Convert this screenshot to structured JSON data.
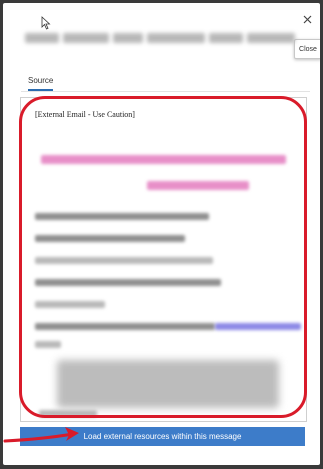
{
  "dialog": {
    "close_tooltip": "Close",
    "tabs": [
      {
        "label": "Source"
      }
    ]
  },
  "content": {
    "external_tag": "[External Email - Use Caution]"
  },
  "footer": {
    "load_external_label": "Load external resources within this message"
  },
  "colors": {
    "accent_blue": "#3d7cc9",
    "annotation_red": "#d91b2a",
    "redacted_pink": "#e06ab6"
  }
}
